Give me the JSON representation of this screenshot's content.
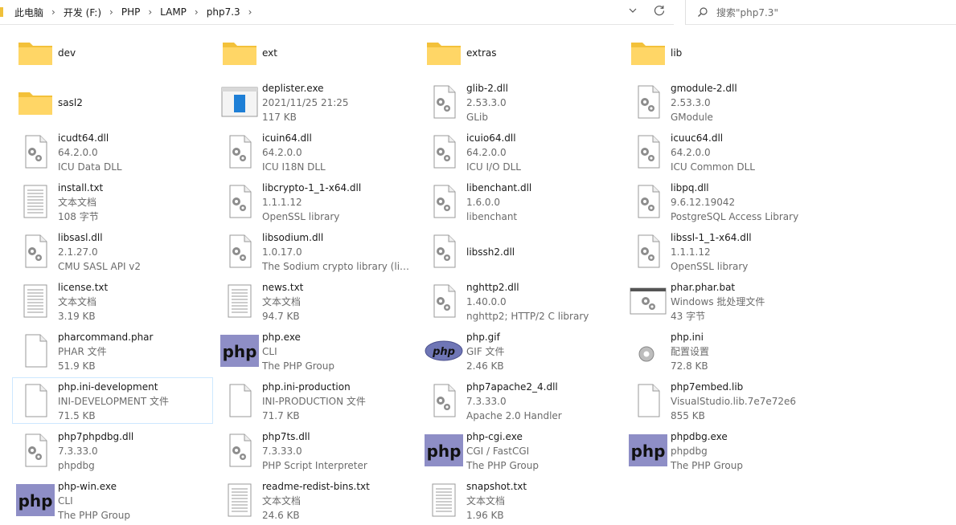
{
  "breadcrumb": [
    "此电脑",
    "开发 (F:)",
    "PHP",
    "LAMP",
    "php7.3"
  ],
  "search": {
    "placeholder": "搜索\"php7.3\""
  },
  "items": [
    {
      "name": "dev",
      "icon": "folder"
    },
    {
      "name": "ext",
      "icon": "folder"
    },
    {
      "name": "extras",
      "icon": "folder"
    },
    {
      "name": "lib",
      "icon": "folder"
    },
    {
      "name": "sasl2",
      "icon": "folder"
    },
    {
      "name": "deplister.exe",
      "icon": "exe-window",
      "line2": "2021/11/25 21:25",
      "line3": "117 KB"
    },
    {
      "name": "glib-2.dll",
      "icon": "dll",
      "line2": "2.53.3.0",
      "line3": "GLib"
    },
    {
      "name": "gmodule-2.dll",
      "icon": "dll",
      "line2": "2.53.3.0",
      "line3": "GModule"
    },
    {
      "name": "icudt64.dll",
      "icon": "dll",
      "line2": "64.2.0.0",
      "line3": "ICU Data DLL"
    },
    {
      "name": "icuin64.dll",
      "icon": "dll",
      "line2": "64.2.0.0",
      "line3": "ICU I18N DLL"
    },
    {
      "name": "icuio64.dll",
      "icon": "dll",
      "line2": "64.2.0.0",
      "line3": "ICU I/O DLL"
    },
    {
      "name": "icuuc64.dll",
      "icon": "dll",
      "line2": "64.2.0.0",
      "line3": "ICU Common DLL"
    },
    {
      "name": "install.txt",
      "icon": "txt",
      "line2": "文本文档",
      "line3": "108 字节"
    },
    {
      "name": "libcrypto-1_1-x64.dll",
      "icon": "dll",
      "line2": "1.1.1.12",
      "line3": "OpenSSL library"
    },
    {
      "name": "libenchant.dll",
      "icon": "dll",
      "line2": "1.6.0.0",
      "line3": "libenchant"
    },
    {
      "name": "libpq.dll",
      "icon": "dll",
      "line2": "9.6.12.19042",
      "line3": "PostgreSQL Access Library"
    },
    {
      "name": "libsasl.dll",
      "icon": "dll",
      "line2": "2.1.27.0",
      "line3": "CMU SASL API v2"
    },
    {
      "name": "libsodium.dll",
      "icon": "dll",
      "line2": "1.0.17.0",
      "line3": "The Sodium crypto library (lib..."
    },
    {
      "name": "libssh2.dll",
      "icon": "dll"
    },
    {
      "name": "libssl-1_1-x64.dll",
      "icon": "dll",
      "line2": "1.1.1.12",
      "line3": "OpenSSL library"
    },
    {
      "name": "license.txt",
      "icon": "txt",
      "line2": "文本文档",
      "line3": "3.19 KB"
    },
    {
      "name": "news.txt",
      "icon": "txt",
      "line2": "文本文档",
      "line3": "94.7 KB"
    },
    {
      "name": "nghttp2.dll",
      "icon": "dll",
      "line2": "1.40.0.0",
      "line3": "nghttp2; HTTP/2 C library"
    },
    {
      "name": "phar.phar.bat",
      "icon": "bat",
      "line2": "Windows 批处理文件",
      "line3": "43 字节"
    },
    {
      "name": "pharcommand.phar",
      "icon": "blank",
      "line2": "PHAR 文件",
      "line3": "51.9 KB"
    },
    {
      "name": "php.exe",
      "icon": "php",
      "line2": "CLI",
      "line3": "The PHP Group"
    },
    {
      "name": "php.gif",
      "icon": "phpgif",
      "line2": "GIF 文件",
      "line3": "2.46 KB"
    },
    {
      "name": "php.ini",
      "icon": "ini",
      "line2": "配置设置",
      "line3": "72.8 KB"
    },
    {
      "name": "php.ini-development",
      "icon": "blank",
      "line2": "INI-DEVELOPMENT 文件",
      "line3": "71.5 KB",
      "selected": true
    },
    {
      "name": "php.ini-production",
      "icon": "blank",
      "line2": "INI-PRODUCTION 文件",
      "line3": "71.7 KB"
    },
    {
      "name": "php7apache2_4.dll",
      "icon": "dll",
      "line2": "7.3.33.0",
      "line3": "Apache 2.0 Handler"
    },
    {
      "name": "php7embed.lib",
      "icon": "blank",
      "line2": "VisualStudio.lib.7e7e72e6",
      "line3": "855 KB"
    },
    {
      "name": "php7phpdbg.dll",
      "icon": "dll",
      "line2": "7.3.33.0",
      "line3": "phpdbg"
    },
    {
      "name": "php7ts.dll",
      "icon": "dll",
      "line2": "7.3.33.0",
      "line3": "PHP Script Interpreter"
    },
    {
      "name": "php-cgi.exe",
      "icon": "php",
      "line2": "CGI / FastCGI",
      "line3": "The PHP Group"
    },
    {
      "name": "phpdbg.exe",
      "icon": "php",
      "line2": "phpdbg",
      "line3": "The PHP Group"
    },
    {
      "name": "php-win.exe",
      "icon": "php",
      "line2": "CLI",
      "line3": "The PHP Group"
    },
    {
      "name": "readme-redist-bins.txt",
      "icon": "txt",
      "line2": "文本文档",
      "line3": "24.6 KB"
    },
    {
      "name": "snapshot.txt",
      "icon": "txt",
      "line2": "文本文档",
      "line3": "1.96 KB"
    }
  ]
}
